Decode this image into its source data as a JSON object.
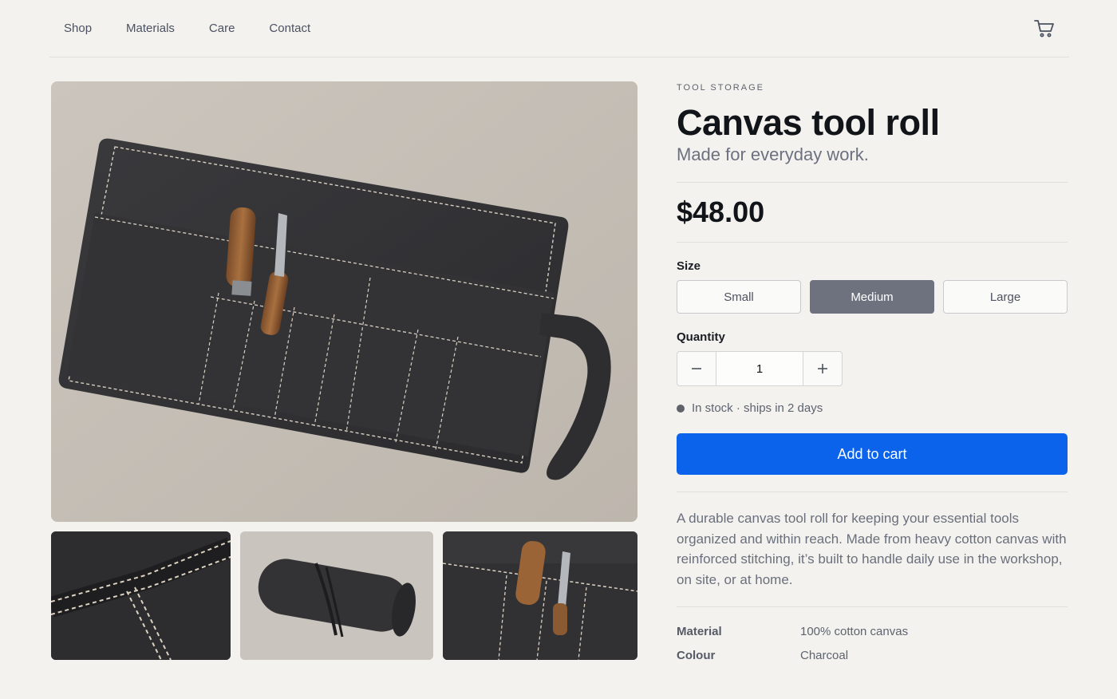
{
  "nav": {
    "links": [
      "Shop",
      "Materials",
      "Care",
      "Contact"
    ],
    "cart_icon": "cart-icon"
  },
  "gallery": {
    "main_image": "canvas tool roll open with tools",
    "thumbnails": [
      "stitching detail",
      "rolled up tool roll",
      "tools in pockets"
    ]
  },
  "product": {
    "category": "TOOL STORAGE",
    "title": "Canvas tool roll",
    "subtitle": "Made for everyday work.",
    "price": "$48.00",
    "size_label": "Size",
    "sizes": [
      "Small",
      "Medium",
      "Large"
    ],
    "selected_size": "Medium",
    "quantity_label": "Quantity",
    "quantity": "1",
    "decrement_icon": "minus-icon",
    "increment_icon": "plus-icon",
    "stock": "In stock · ships in 2 days",
    "add_to_cart": "Add to cart",
    "description": "A durable canvas tool roll for keeping your essential tools organized and within reach. Made from heavy cotton canvas with reinforced stitching, it’s built to handle daily use in the workshop, on site, or at home.",
    "specs": [
      {
        "label": "Material",
        "value": "100% cotton canvas"
      },
      {
        "label": "Colour",
        "value": "Charcoal"
      }
    ]
  },
  "colors": {
    "accent": "#0b63ec",
    "selected_size": "#6d727e",
    "background": "#f3f2ee"
  }
}
